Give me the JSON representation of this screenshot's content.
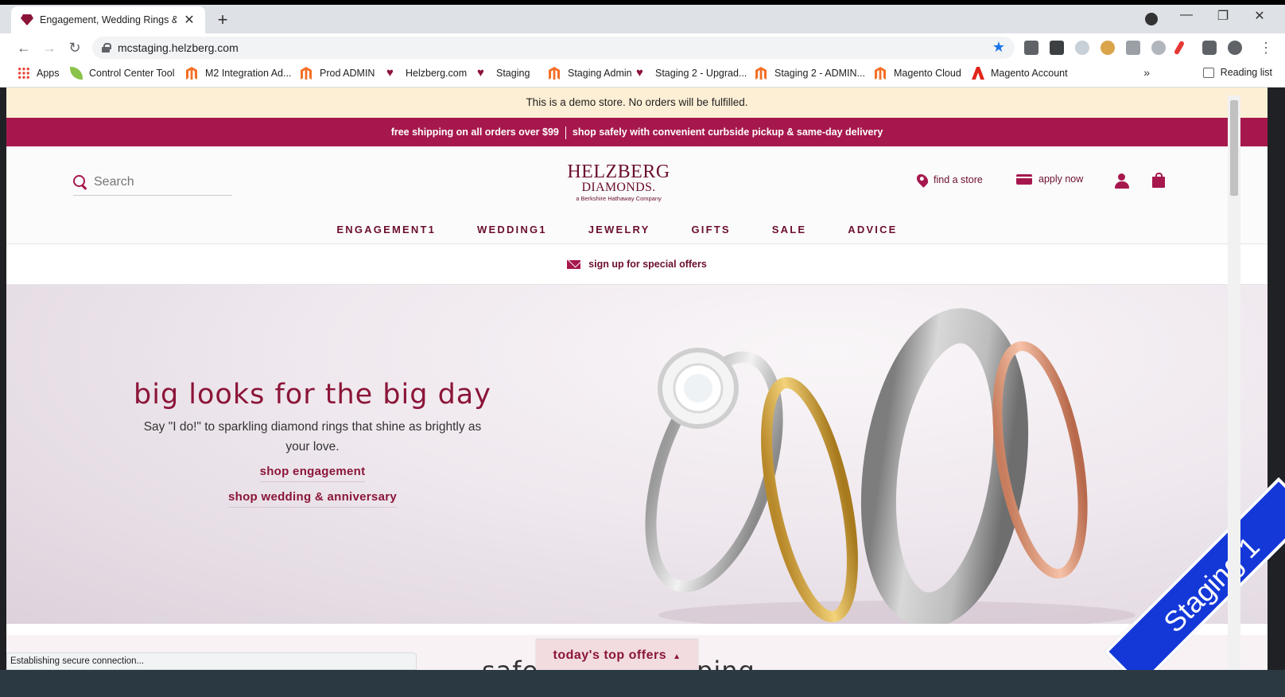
{
  "browser": {
    "tab_title": "Engagement, Wedding Rings & F",
    "new_tab": "+",
    "tab_close": "✕",
    "url": "mcstaging.helzberg.com",
    "window_controls": [
      "—",
      "❐",
      "✕"
    ],
    "bookmarks": [
      {
        "label": "Apps",
        "icon": "apps-grid-icon"
      },
      {
        "label": "Control Center Tool",
        "icon": "leaf-icon"
      },
      {
        "label": "M2 Integration Ad...",
        "icon": "magento-icon"
      },
      {
        "label": "Prod ADMIN",
        "icon": "magento-icon"
      },
      {
        "label": "Helzberg.com",
        "icon": "heart-icon"
      },
      {
        "label": "Staging",
        "icon": "heart-icon"
      },
      {
        "label": "Staging Admin",
        "icon": "magento-icon"
      },
      {
        "label": "Staging 2 - Upgrad...",
        "icon": "heart-icon"
      },
      {
        "label": "Staging 2 - ADMIN...",
        "icon": "magento-icon"
      },
      {
        "label": "Magento Cloud",
        "icon": "magento-icon"
      },
      {
        "label": "Magento Account",
        "icon": "adobe-icon"
      }
    ],
    "more_bookmarks": "»",
    "reading_list": "Reading list",
    "status_text": "Establishing secure connection..."
  },
  "site": {
    "demo_notice": "This is a demo store. No orders will be fulfilled.",
    "promo_left": "free shipping on all orders over $99",
    "promo_right": "shop safely with convenient curbside pickup & same-day delivery",
    "search_placeholder": "Search",
    "logo": {
      "line1": "HELZBERG",
      "line2": "DIAMONDS.",
      "tagline": "a Berkshire Hathaway Company"
    },
    "find_store": "find a store",
    "apply_now": "apply now",
    "nav": [
      "ENGAGEMENT1",
      "WEDDING1",
      "JEWELRY",
      "GIFTS",
      "SALE",
      "ADVICE"
    ],
    "signup": "sign up for special offers",
    "hero": {
      "title": "big looks for the big day",
      "subtitle": "Say \"I do!\" to sparkling diamond rings that shine as brightly as your love.",
      "cta1": "shop engagement",
      "cta2": "shop wedding & anniversary"
    },
    "section_title_left": "safe",
    "section_title_right": "ping",
    "offers_tab": "today's top offers",
    "offers_caret": "▲",
    "staging_ribbon": "Staging 1"
  },
  "colors": {
    "brand": "#a6184d",
    "brand_dark": "#6b0f2c",
    "ribbon": "#1438d8",
    "demo_bar": "#fdefd5"
  }
}
